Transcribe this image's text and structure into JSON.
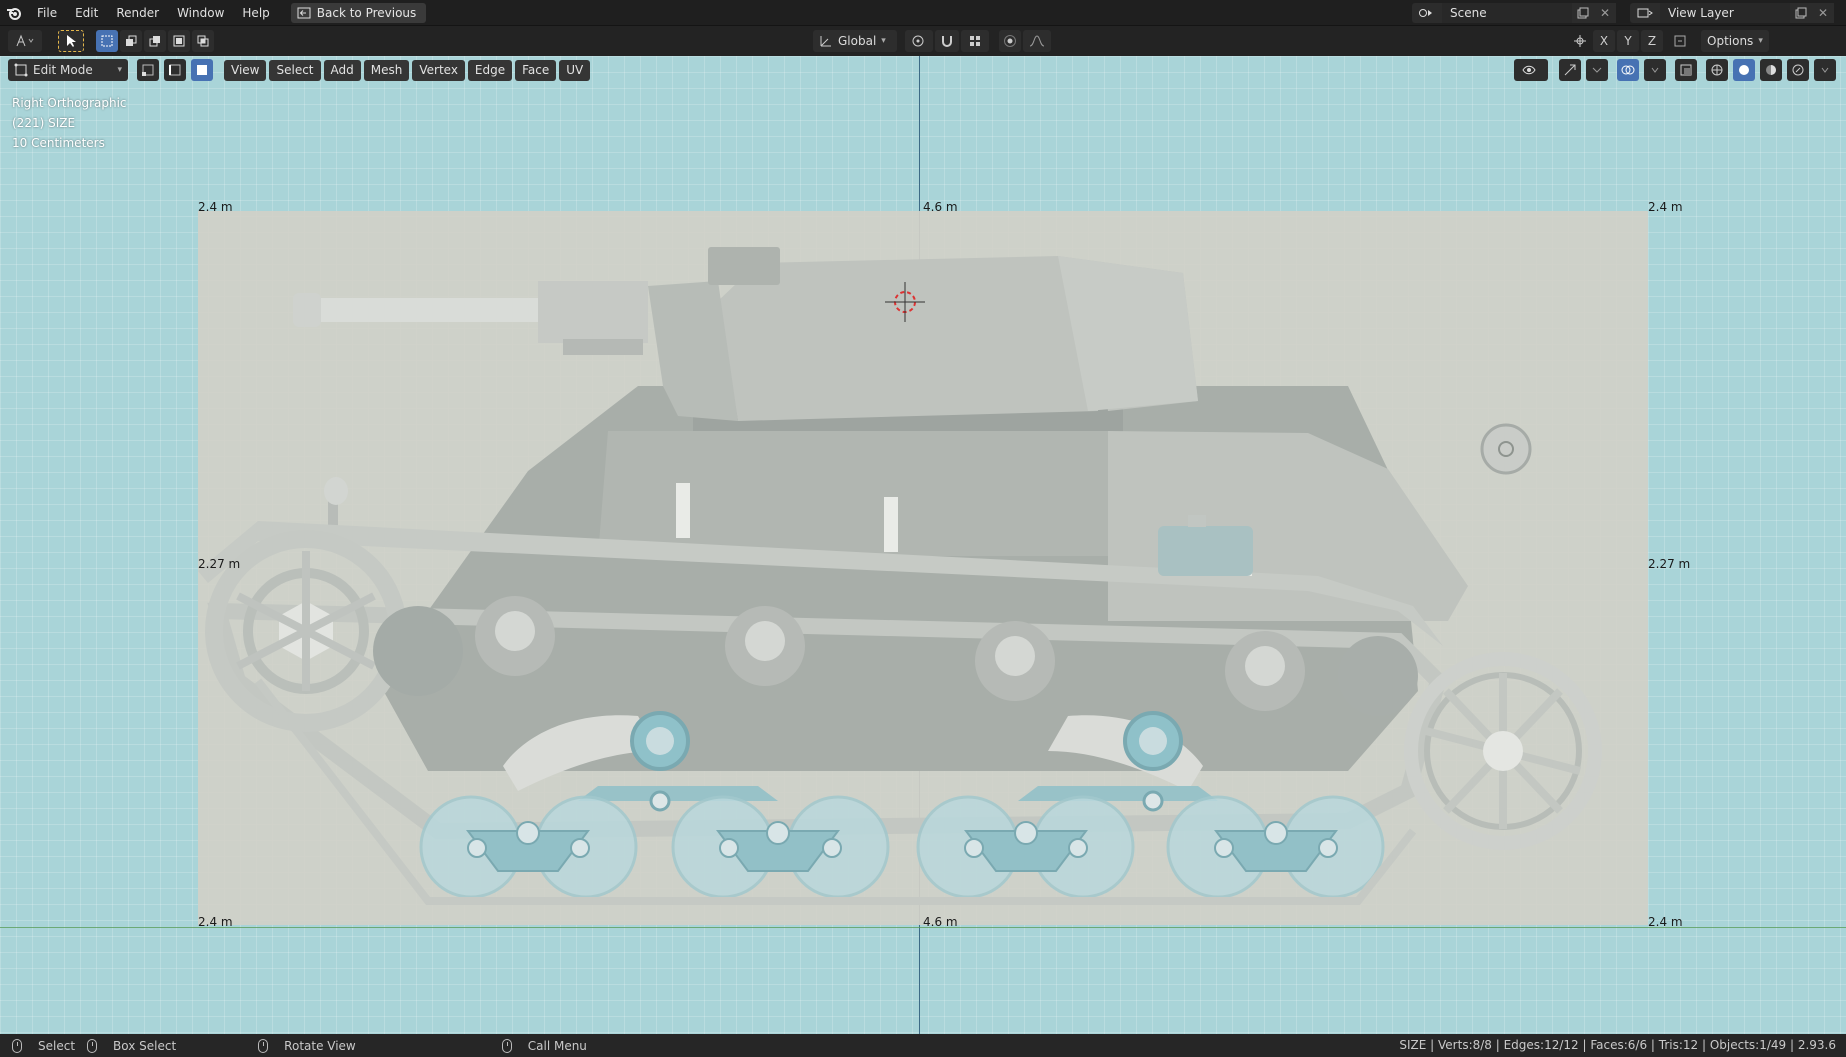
{
  "menubar": {
    "items": [
      "File",
      "Edit",
      "Render",
      "Window",
      "Help"
    ],
    "back_label": "Back to Previous",
    "scene_label": "Scene",
    "view_layer_label": "View Layer"
  },
  "toolbar": {
    "transform_orientation": "Global",
    "axes": [
      "X",
      "Y",
      "Z"
    ],
    "options_label": "Options"
  },
  "viewport_header": {
    "mode": "Edit Mode",
    "menus": [
      "View",
      "Select",
      "Add",
      "Mesh",
      "Vertex",
      "Edge",
      "Face",
      "UV"
    ]
  },
  "overlay": {
    "view_name": "Right Orthographic",
    "object_info": "(221) SIZE",
    "grid_scale": "10 Centimeters"
  },
  "dimensions": {
    "top_left": "2.4 m",
    "top_center": "4.6 m",
    "top_right": "2.4 m",
    "mid_left": "2.27 m",
    "mid_right": "2.27 m",
    "bottom_left": "2.4 m",
    "bottom_center": "4.6 m",
    "bottom_right": "2.4 m"
  },
  "statusbar": {
    "select": "Select",
    "box_select": "Box Select",
    "rotate_view": "Rotate View",
    "call_menu": "Call Menu",
    "stats": "SIZE | Verts:8/8 | Edges:12/12 | Faces:6/6 | Tris:12 | Objects:1/49 | 2.93.6"
  },
  "colors": {
    "viewport_bg": "#a9d4d8",
    "active_button": "#4772b3",
    "tank_body": "#b9bdb8",
    "tank_shadow": "#9ea4a0",
    "road_wheel_tint": "#8fc1c9"
  }
}
